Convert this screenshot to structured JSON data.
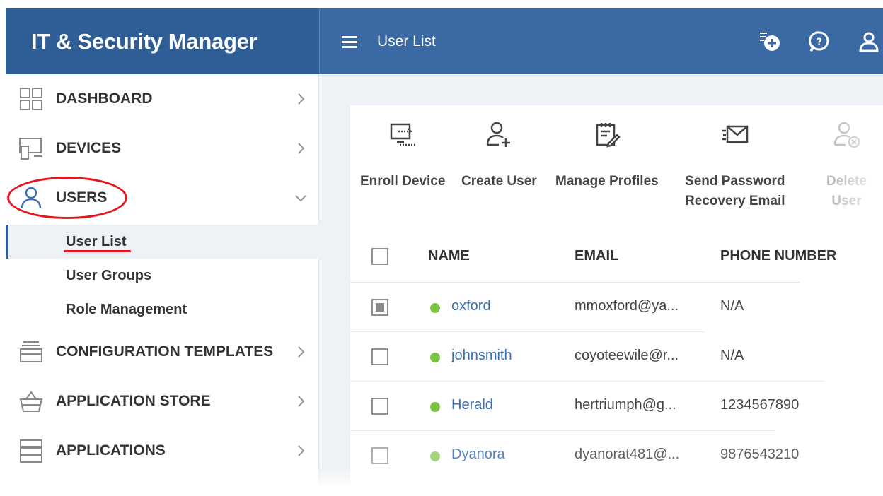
{
  "header": {
    "brand": "IT & Security Manager",
    "page_title": "User List",
    "icons": [
      "add-notification-icon",
      "help-icon",
      "user-profile-icon"
    ]
  },
  "sidebar": {
    "items": [
      {
        "label": "DASHBOARD",
        "icon": "dashboard-grid-icon",
        "expanded": false
      },
      {
        "label": "DEVICES",
        "icon": "devices-icon",
        "expanded": false
      },
      {
        "label": "USERS",
        "icon": "user-icon",
        "expanded": true
      },
      {
        "label": "CONFIGURATION TEMPLATES",
        "icon": "templates-icon",
        "expanded": false
      },
      {
        "label": "APPLICATION STORE",
        "icon": "store-basket-icon",
        "expanded": false
      },
      {
        "label": "APPLICATIONS",
        "icon": "applications-icon",
        "expanded": false
      }
    ],
    "users_subitems": [
      "User List",
      "User Groups",
      "Role Management"
    ],
    "active_subitem": "User List",
    "highlight_color": "#e8141b"
  },
  "toolbar": {
    "buttons": [
      {
        "label": "Enroll Device",
        "icon": "enroll-device-icon"
      },
      {
        "label": "Create User",
        "icon": "create-user-icon"
      },
      {
        "label": "Manage Profiles",
        "icon": "manage-profiles-icon"
      },
      {
        "label": "Send Password\nRecovery Email",
        "icon": "email-icon"
      },
      {
        "label": "Delete User",
        "icon": "delete-user-icon",
        "disabled": true
      }
    ]
  },
  "table": {
    "columns": [
      "NAME",
      "EMAIL",
      "PHONE NUMBER"
    ],
    "rows": [
      {
        "name": "oxford",
        "email": "mmoxford@ya...",
        "phone": "N/A",
        "selected": true
      },
      {
        "name": "johnsmith",
        "email": "coyoteewile@r...",
        "phone": "N/A",
        "selected": false
      },
      {
        "name": "Herald",
        "email": "hertriumph@g...",
        "phone": "1234567890",
        "selected": false
      },
      {
        "name": "Dyanora",
        "email": "dyanorat481@...",
        "phone": "9876543210",
        "selected": false
      }
    ]
  },
  "colors": {
    "brand_bg": "#2f5e97",
    "topbar_bg": "#3a69a3",
    "link": "#3b6fb4",
    "online_dot": "#7cc242"
  }
}
